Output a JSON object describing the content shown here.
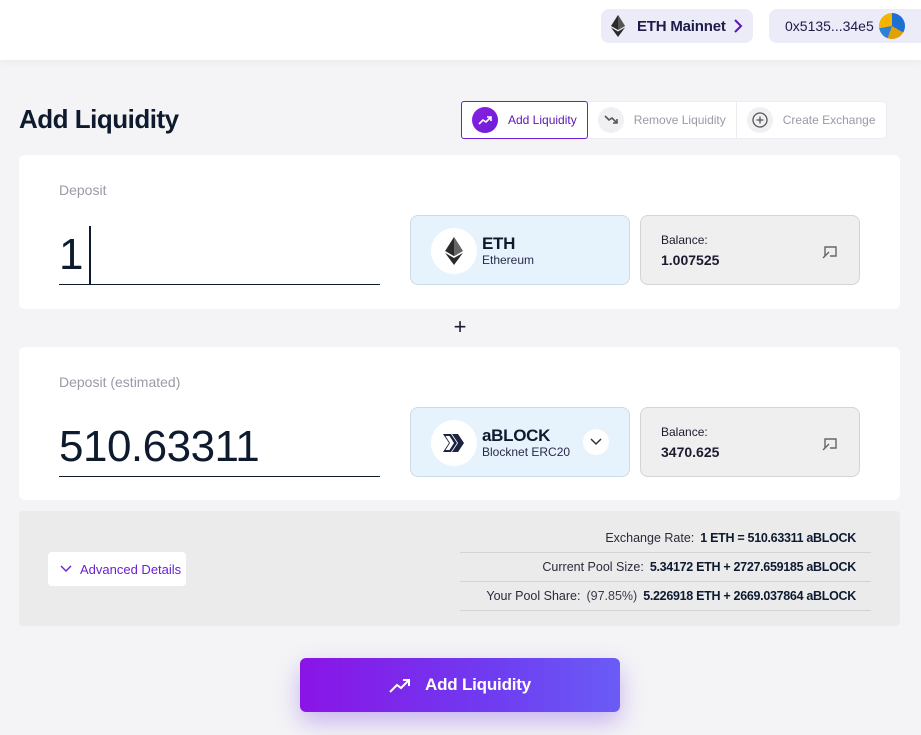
{
  "header": {
    "network_label": "ETH Mainnet",
    "wallet_address": "0x5135...34e5"
  },
  "page": {
    "title": "Add Liquidity"
  },
  "tabs": [
    {
      "label": "Add Liquidity",
      "active": true
    },
    {
      "label": "Remove Liquidity",
      "active": false
    },
    {
      "label": "Create Exchange",
      "active": false
    }
  ],
  "deposit": {
    "label": "Deposit",
    "amount": "1",
    "token_symbol": "ETH",
    "token_name": "Ethereum",
    "balance_label": "Balance:",
    "balance_value": "1.007525"
  },
  "plus_symbol": "+",
  "deposit_estimated": {
    "label": "Deposit (estimated)",
    "amount": "510.63311",
    "token_symbol": "aBLOCK",
    "token_name": "Blocknet ERC20",
    "balance_label": "Balance:",
    "balance_value": "3470.625"
  },
  "details": {
    "advanced_label": "Advanced Details",
    "rows": [
      {
        "key": "Exchange Rate:",
        "prefix": "",
        "value": "1 ETH = 510.63311 aBLOCK"
      },
      {
        "key": "Current Pool Size:",
        "prefix": "",
        "value": "5.34172 ETH + 2727.659185 aBLOCK"
      },
      {
        "key": "Your Pool Share:",
        "prefix": "(97.85%)",
        "value": "5.226918 ETH + 2669.037864 aBLOCK"
      }
    ]
  },
  "cta": {
    "label": "Add Liquidity"
  },
  "colors": {
    "accent": "#6a1fd6",
    "token_bg": "#e6f3fd",
    "text_dark": "#0e1a2e"
  }
}
